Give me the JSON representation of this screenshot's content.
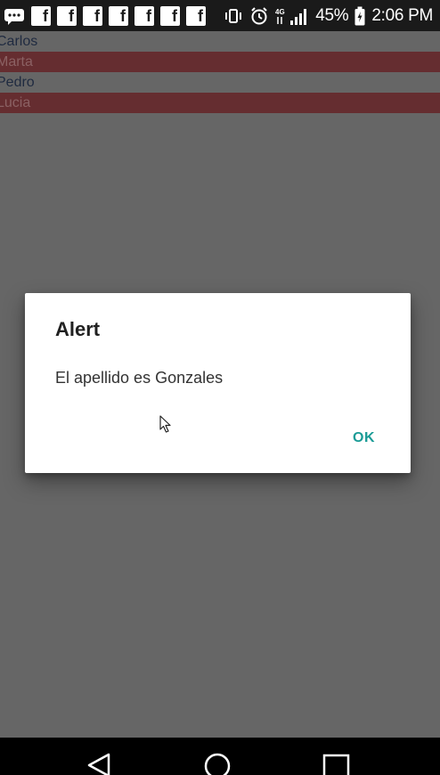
{
  "status_bar": {
    "notification_icons": [
      "messenger-icon",
      "facebook-icon",
      "facebook-icon",
      "facebook-icon",
      "facebook-icon",
      "facebook-icon",
      "facebook-icon",
      "facebook-icon"
    ],
    "facebook_glyph": "f",
    "battery_percent": "45%",
    "time": "2:06 PM",
    "network_label": "4G"
  },
  "list": {
    "items": [
      {
        "label": "Carlos"
      },
      {
        "label": "Marta"
      },
      {
        "label": "Pedro"
      },
      {
        "label": "Lucia"
      }
    ]
  },
  "dialog": {
    "title": "Alert",
    "message": "El apellido es Gonzales",
    "ok_label": "OK"
  },
  "colors": {
    "background_dim": "#666666",
    "alt_row": "#652d30",
    "accent": "#1a9b96"
  }
}
